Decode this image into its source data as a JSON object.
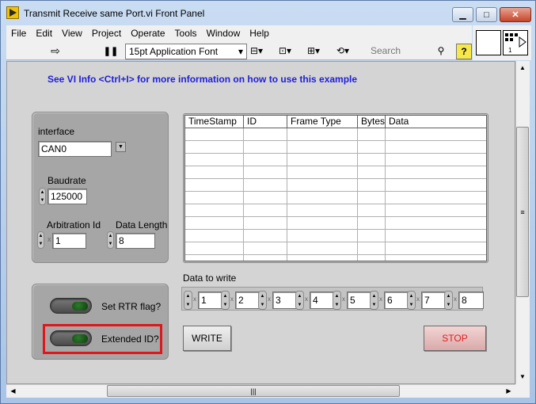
{
  "window": {
    "title": "Transmit Receive same Port.vi Front Panel"
  },
  "menu": [
    "File",
    "Edit",
    "View",
    "Project",
    "Operate",
    "Tools",
    "Window",
    "Help"
  ],
  "toolbar": {
    "font": "15pt Application Font",
    "search_placeholder": "Search",
    "help_label": "?"
  },
  "connector_pane_number": "1",
  "info_text": "See VI Info <Ctrl+I> for more information on how to use this example",
  "config": {
    "interface_label": "interface",
    "interface_value": "CAN0",
    "baudrate_label": "Baudrate",
    "baudrate_value": "125000",
    "arbitration_label": "Arbitration Id",
    "arbitration_radix": "x",
    "arbitration_value": "1",
    "data_length_label": "Data Length",
    "data_length_value": "8"
  },
  "table": {
    "columns": [
      "TimeStamp",
      "ID",
      "Frame Type",
      "Bytes",
      "Data"
    ]
  },
  "data_to_write": {
    "label": "Data to write",
    "radix": "x",
    "values": [
      "1",
      "2",
      "3",
      "4",
      "5",
      "6",
      "7",
      "8"
    ]
  },
  "buttons": {
    "write": "WRITE",
    "stop": "STOP"
  },
  "switches": {
    "rtr_label": "Set RTR flag?",
    "extended_label": "Extended ID?"
  },
  "colors": {
    "info_text": "#2020d8",
    "stop_text": "#e02020",
    "highlight": "#e0161a",
    "led": "#2e7a2e"
  }
}
